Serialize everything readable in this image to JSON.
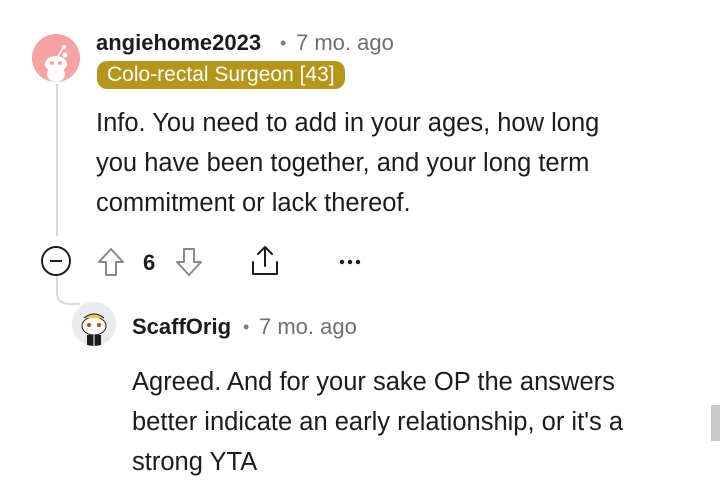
{
  "comment": {
    "username": "angiehome2023",
    "separator": "•",
    "time": "7 mo. ago",
    "flair": "Colo-rectal Surgeon [43]",
    "body_lines": [
      "Info. You need to add in your ages, how long",
      "you have been together, and your long term",
      "commitment or lack thereof."
    ],
    "vote_count": "6",
    "avatar_color": "#f5a3a3",
    "flair_color": "#b5951a"
  },
  "reply": {
    "username": "ScaffOrig",
    "separator": "•",
    "time": "7 mo. ago",
    "body_lines": [
      "Agreed. And for your sake OP the answers",
      "better indicate an early relationship, or it's a",
      "strong YTA"
    ]
  },
  "icons": {
    "collapse": "collapse-minus-icon",
    "upvote": "upvote-arrow-icon",
    "downvote": "downvote-arrow-icon",
    "share": "share-icon",
    "more": "more-options-icon"
  }
}
